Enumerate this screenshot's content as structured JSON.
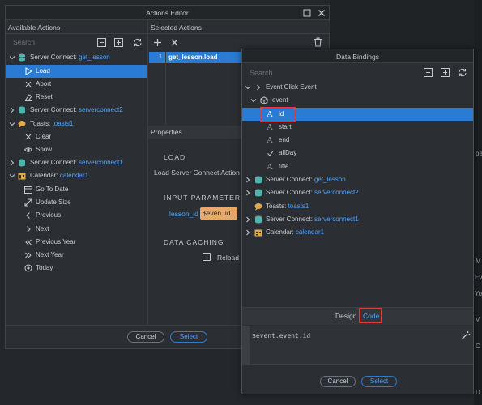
{
  "actions_editor": {
    "title": "Actions Editor",
    "available_header": "Available Actions",
    "selected_header": "Selected Actions",
    "search_placeholder": "Search",
    "tree": [
      {
        "prefix": "Server Connect: ",
        "name": "get_lesson"
      },
      {
        "label": "Load"
      },
      {
        "label": "Abort"
      },
      {
        "label": "Reset"
      },
      {
        "prefix": "Server Connect: ",
        "name": "serverconnect2"
      },
      {
        "prefix": "Toasts: ",
        "name": "toasts1"
      },
      {
        "label": "Clear"
      },
      {
        "label": "Show"
      },
      {
        "prefix": "Server Connect: ",
        "name": "serverconnect1"
      },
      {
        "prefix": "Calendar: ",
        "name": "calendar1"
      },
      {
        "label": "Go To Date"
      },
      {
        "label": "Update Size"
      },
      {
        "label": "Previous"
      },
      {
        "label": "Next"
      },
      {
        "label": "Previous Year"
      },
      {
        "label": "Next Year"
      },
      {
        "label": "Today"
      }
    ],
    "selected_action": {
      "index": "1",
      "label": "get_lesson.load"
    },
    "properties_header": "Properties",
    "load_heading": "LOAD",
    "load_desc": "Load Server Connect Action",
    "input_params_heading": "INPUT PARAMETERS",
    "param_name": "lesson_id",
    "param_value": "$even..id",
    "caching_heading": "DATA CACHING",
    "reload_label": "Reload",
    "cancel_label": "Cancel",
    "select_label": "Select"
  },
  "data_bindings": {
    "title": "Data Bindings",
    "search_placeholder": "Search",
    "tree": [
      {
        "label": "Event Click Event"
      },
      {
        "label": "event"
      },
      {
        "label": "id"
      },
      {
        "label": "start"
      },
      {
        "label": "end"
      },
      {
        "label": "allDay"
      },
      {
        "label": "title"
      },
      {
        "prefix": "Server Connect: ",
        "name": "get_lesson"
      },
      {
        "prefix": "Server Connect: ",
        "name": "serverconnect2"
      },
      {
        "prefix": "Toasts: ",
        "name": "toasts1"
      },
      {
        "prefix": "Server Connect: ",
        "name": "serverconnect1"
      },
      {
        "prefix": "Calendar: ",
        "name": "calendar1"
      }
    ],
    "tab_design": "Design",
    "tab_code": "Code",
    "code_value": "$event.event.id",
    "cancel_label": "Cancel",
    "select_label": "Select"
  },
  "background": {
    "side_fragments": [
      "pe",
      "M",
      "Eve",
      "You",
      "V",
      "C",
      "D"
    ]
  },
  "colors": {
    "accent": "#2a7bd3",
    "link": "#4aa3ff",
    "highlight": "#e53935",
    "param_bg": "#e8a96a"
  }
}
